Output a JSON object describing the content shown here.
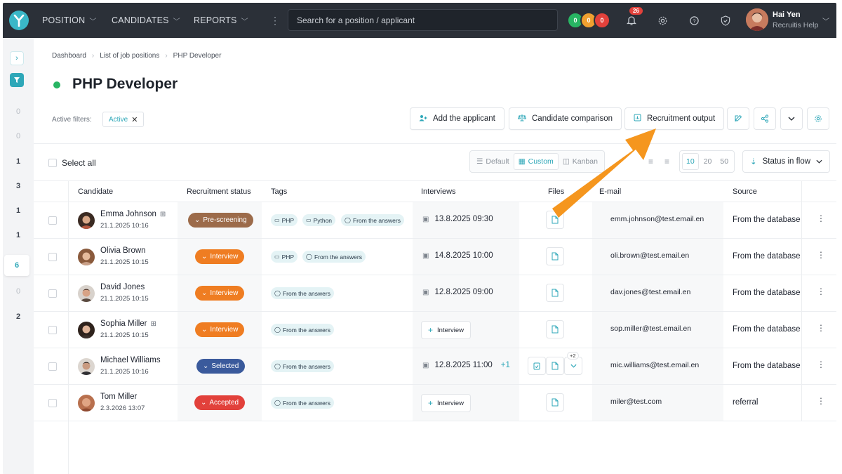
{
  "topbar": {
    "nav": [
      {
        "label": "POSITION"
      },
      {
        "label": "CANDIDATES"
      },
      {
        "label": "REPORTS"
      }
    ],
    "search_placeholder": "Search for a position / applicant",
    "status_circles": [
      {
        "label": "0",
        "color": "#28b563"
      },
      {
        "label": "0",
        "color": "#f0a030"
      },
      {
        "label": "0",
        "color": "#e2413b"
      }
    ],
    "notifications_count": "26",
    "user": {
      "name": "Hai Yen",
      "subtitle": "Recruitis Help"
    }
  },
  "rail": {
    "counts": [
      "0",
      "0",
      "1",
      "3",
      "1",
      "1",
      "6",
      "0",
      "2"
    ],
    "active_count": "6"
  },
  "breadcrumb": [
    "Dashboard",
    "List of job positions",
    "PHP Developer"
  ],
  "page_title": "PHP Developer",
  "status_color": "#28b563",
  "filters": {
    "label": "Active filters:",
    "chips": [
      "Active"
    ]
  },
  "actions": {
    "add_applicant": "Add the applicant",
    "candidate_comparison": "Candidate comparison",
    "recruitment_output": "Recruitment output"
  },
  "toolbar": {
    "select_all": "Select all",
    "views": [
      "Default",
      "Custom",
      "Kanban"
    ],
    "active_view": "Custom",
    "page_sizes": [
      "10",
      "20",
      "50"
    ],
    "active_page_size": "10",
    "status_in_flow": "Status in flow"
  },
  "table": {
    "headers": [
      "Candidate",
      "Recruitment status",
      "Tags",
      "Interviews",
      "Files",
      "E-mail",
      "Source"
    ],
    "rows": [
      {
        "name": "Emma Johnson",
        "date": "21.1.2025 10:16",
        "has_tree": true,
        "status": "Pre-screening",
        "status_color": "#9c6b4a",
        "tags": [
          {
            "icon": "monitor",
            "label": "PHP"
          },
          {
            "icon": "monitor",
            "label": "Python"
          },
          {
            "icon": "chat",
            "label": "From the answers"
          }
        ],
        "interview": "13.8.2025 09:30",
        "interview_extra": "",
        "email": "emm.johnson@test.email.en",
        "source": "From the database"
      },
      {
        "name": "Olivia Brown",
        "date": "21.1.2025 10:15",
        "has_tree": false,
        "status": "Interview",
        "status_color": "#ef7d22",
        "tags": [
          {
            "icon": "monitor",
            "label": "PHP"
          },
          {
            "icon": "chat",
            "label": "From the answers"
          }
        ],
        "interview": "14.8.2025 10:00",
        "interview_extra": "",
        "email": "oli.brown@test.email.en",
        "source": "From the database"
      },
      {
        "name": "David Jones",
        "date": "21.1.2025 10:15",
        "has_tree": false,
        "status": "Interview",
        "status_color": "#ef7d22",
        "tags": [
          {
            "icon": "chat",
            "label": "From the answers"
          }
        ],
        "interview": "12.8.2025 09:00",
        "interview_extra": "",
        "email": "dav.jones@test.email.en",
        "source": "From the database"
      },
      {
        "name": "Sophia Miller",
        "date": "21.1.2025 10:15",
        "has_tree": true,
        "status": "Interview",
        "status_color": "#ef7d22",
        "tags": [
          {
            "icon": "chat",
            "label": "From the answers"
          }
        ],
        "interview": "",
        "interview_button": "Interview",
        "email": "sop.miller@test.email.en",
        "source": "From the database"
      },
      {
        "name": "Michael Williams",
        "date": "21.1.2025 10:16",
        "has_tree": false,
        "status": "Selected",
        "status_color": "#3a5a9c",
        "tags": [
          {
            "icon": "chat",
            "label": "From the answers"
          }
        ],
        "interview": "12.8.2025 11:00",
        "interview_extra": "+1",
        "files_badge": "+2",
        "email": "mic.williams@test.email.en",
        "source": "From the database"
      },
      {
        "name": "Tom Miller",
        "date": "2.3.2026 13:07",
        "has_tree": false,
        "status": "Accepted",
        "status_color": "#e2413b",
        "tags": [
          {
            "icon": "chat",
            "label": "From the answers"
          }
        ],
        "interview": "",
        "interview_button": "Interview",
        "email": "miler@test.com",
        "source": "referral"
      }
    ]
  },
  "accent": "#2ea7b8",
  "arrow_color": "#f5961e"
}
